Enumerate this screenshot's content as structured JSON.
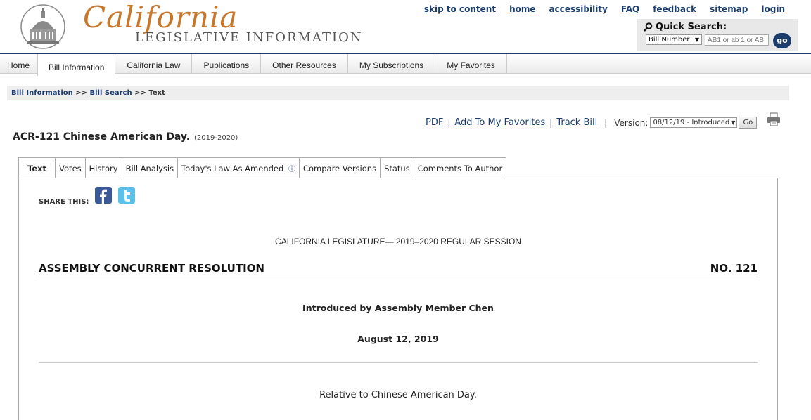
{
  "header": {
    "logo_script": "California",
    "logo_sub": "LEGISLATIVE INFORMATION",
    "top_links": [
      "skip to content",
      "home",
      "accessibility",
      "FAQ",
      "feedback",
      "sitemap",
      "login"
    ],
    "quick_search": {
      "label": "Quick Search:",
      "select_value": "Bill Number",
      "input_placeholder": "AB1 or ab 1 or AB",
      "go_label": "go"
    }
  },
  "nav": {
    "items": [
      "Home",
      "Bill Information",
      "California Law",
      "Publications",
      "Other Resources",
      "My Subscriptions",
      "My Favorites"
    ],
    "active": "Bill Information"
  },
  "breadcrumb": {
    "link1": "Bill Information",
    "sep1": ">>",
    "link2": "Bill Search",
    "sep2": ">>",
    "current": "Text"
  },
  "tools": {
    "pdf": "PDF",
    "favorites": "Add To My Favorites",
    "track": "Track Bill",
    "version_label": "Version:",
    "version_value": "08/12/19 - Introduced",
    "go": "Go"
  },
  "bill": {
    "title": "ACR-121 Chinese American Day.",
    "session": "(2019-2020)"
  },
  "tabs": [
    "Text",
    "Votes",
    "History",
    "Bill Analysis",
    "Today's Law As Amended",
    "Compare Versions",
    "Status",
    "Comments To Author"
  ],
  "content": {
    "share_label": "SHARE THIS:",
    "session_line": "CALIFORNIA LEGISLATURE— 2019–2020 REGULAR SESSION",
    "resolution_title": "ASSEMBLY CONCURRENT RESOLUTION",
    "resolution_no": "NO. 121",
    "introduced_by": "Introduced by Assembly Member Chen",
    "date": "August 12, 2019",
    "relative_to": "Relative to Chinese American Day."
  },
  "colors": {
    "brand_navy": "#1b3d6e",
    "logo_orange": "#c8772a"
  }
}
